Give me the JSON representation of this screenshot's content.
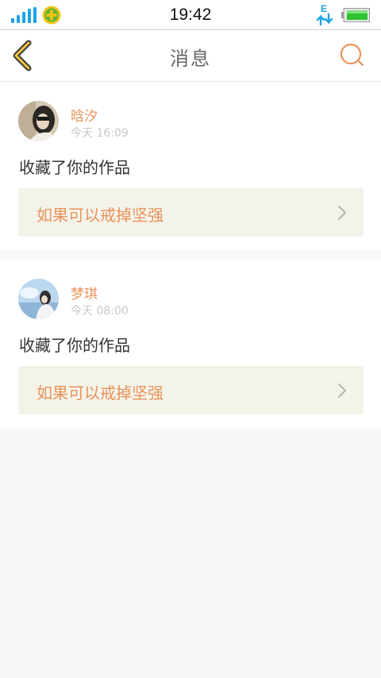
{
  "status_bar": {
    "time": "19:42",
    "signal_icon": "signal-bars-icon",
    "app_icon": "360-security-icon",
    "data_icon": "data-transfer-e-icon",
    "battery_icon": "battery-icon",
    "data_label": "E",
    "accent_color": "#1aa3e8"
  },
  "header": {
    "title": "消息",
    "back_icon": "chevron-left-icon",
    "search_icon": "search-icon",
    "accent_color": "#e8935a"
  },
  "messages": [
    {
      "username": "晗汐",
      "time": "今天 16:09",
      "action": "收藏了你的作品",
      "work_title": "如果可以戒掉坚强",
      "avatar": "user-avatar-photo"
    },
    {
      "username": "梦琪",
      "time": "今天 08:00",
      "action": "收藏了你的作品",
      "work_title": "如果可以戒掉坚强",
      "avatar": "user-avatar-photo"
    }
  ]
}
